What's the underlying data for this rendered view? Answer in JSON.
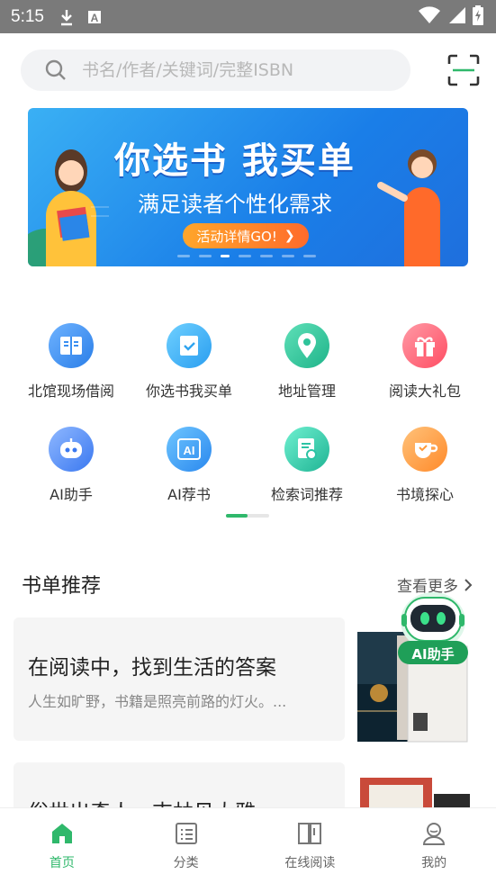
{
  "status_bar": {
    "time": "5:15"
  },
  "search": {
    "placeholder": "书名/作者/关键词/完整ISBN"
  },
  "banner": {
    "title": "你选书 我买单",
    "subtitle": "满足读者个性化需求",
    "button": "活动详情GO!"
  },
  "shortcuts": [
    {
      "label": "北馆现场借阅",
      "icon": "book-open-icon",
      "color": "#3a8ff2"
    },
    {
      "label": "你选书我买单",
      "icon": "book-check-icon",
      "color": "#2fa4f0"
    },
    {
      "label": "地址管理",
      "icon": "location-pin-icon",
      "color": "#2fc39a"
    },
    {
      "label": "阅读大礼包",
      "icon": "gift-icon",
      "color": "#ff5c6e"
    },
    {
      "label": "AI助手",
      "icon": "robot-icon",
      "color": "#4f8ff7"
    },
    {
      "label": "AI荐书",
      "icon": "ai-book-icon",
      "color": "#3aa2f1"
    },
    {
      "label": "检索词推荐",
      "icon": "document-search-icon",
      "color": "#2cc3a4"
    },
    {
      "label": "书境探心",
      "icon": "coffee-cup-icon",
      "color": "#ff9a3a"
    }
  ],
  "section": {
    "title": "书单推荐",
    "more": "查看更多"
  },
  "book_lists": [
    {
      "title": "在阅读中，找到生活的答案",
      "subtitle": "人生如旷野，书籍是照亮前路的灯火。..."
    },
    {
      "title": "俗世出奇人，吉林见大雅",
      "subtitle": ""
    }
  ],
  "ai_float": {
    "label": "AI助手"
  },
  "tabbar": [
    {
      "label": "首页",
      "icon": "home-icon",
      "active": true
    },
    {
      "label": "分类",
      "icon": "list-icon",
      "active": false
    },
    {
      "label": "在线阅读",
      "icon": "open-book-icon",
      "active": false
    },
    {
      "label": "我的",
      "icon": "user-icon",
      "active": false
    }
  ]
}
